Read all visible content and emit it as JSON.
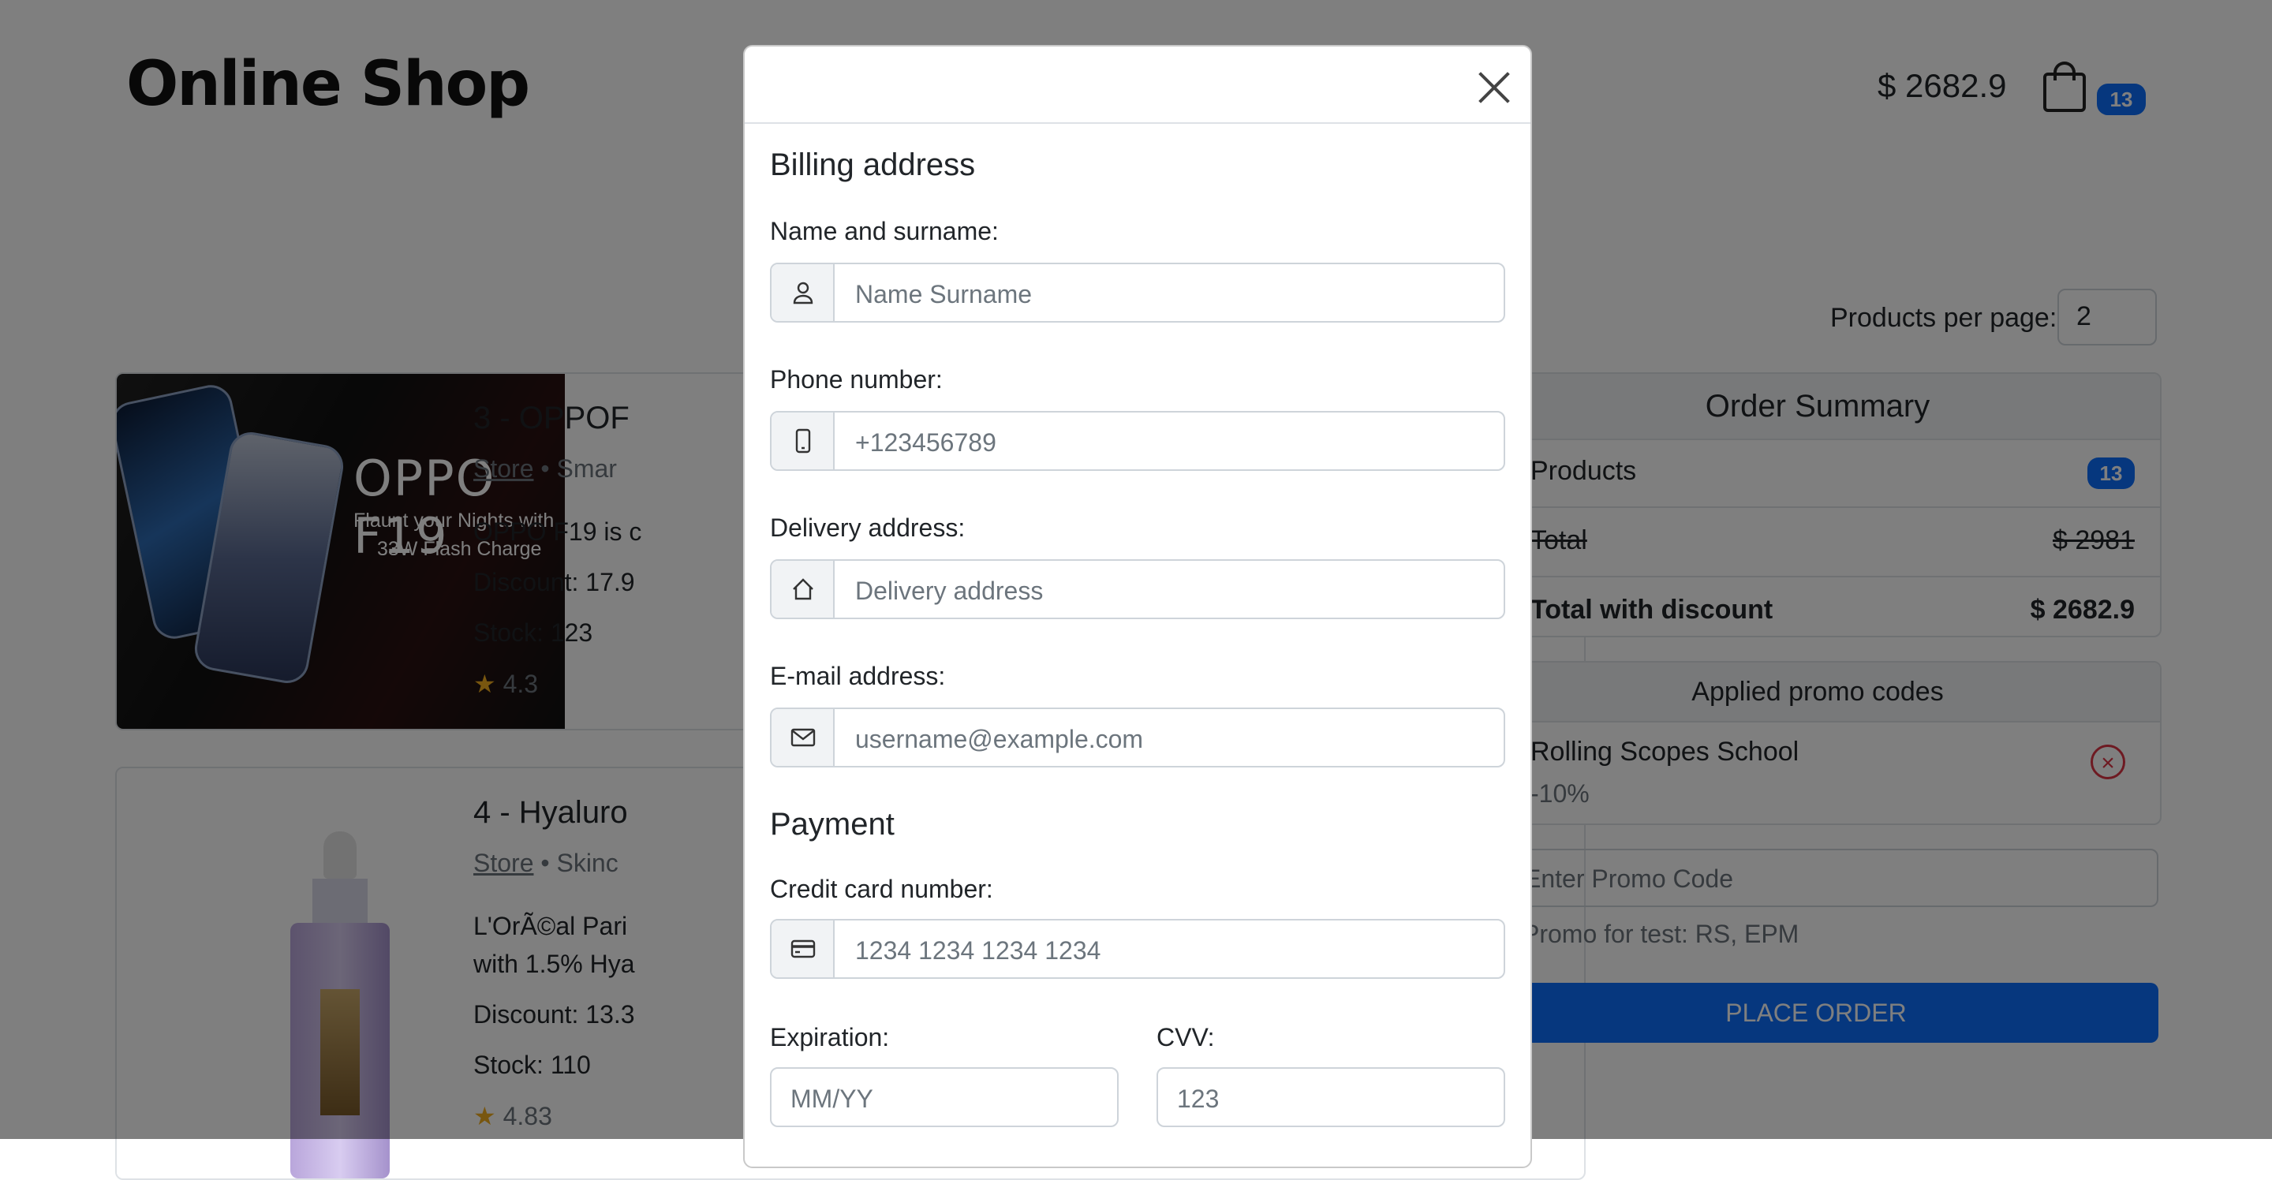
{
  "header": {
    "brand": "Online Shop",
    "total_price": "$ 2682.9",
    "cart_count": "13"
  },
  "controls": {
    "products_per_page_label": "Products per page:",
    "products_per_page_value": "2"
  },
  "products": [
    {
      "title": "3 - OPPOF",
      "store": "Store",
      "category": "Smar",
      "description": "OPPO F19 is c",
      "discount": "Discount: 17.9",
      "stock": "Stock: 123",
      "rating": "4.3",
      "image_text": {
        "title": "OPPO F19",
        "line1": "Flaunt your Nights with",
        "line2": "33W Flash Charge"
      }
    },
    {
      "title": "4 - Hyaluro",
      "store": "Store",
      "category": "Skinc",
      "description_line1": "L'OrÃ©al Pari",
      "description_line2": "with 1.5% Hya",
      "discount": "Discount: 13.3",
      "stock": "Stock: 110",
      "rating": "4.83"
    }
  ],
  "summary": {
    "title": "Order Summary",
    "products_label": "Products",
    "products_count": "13",
    "total_label": "Total",
    "total_value": "$ 2981",
    "discount_label": "Total with discount",
    "discount_value": "$ 2682.9"
  },
  "promo": {
    "title": "Applied promo codes",
    "code_name": "Rolling Scopes School",
    "code_discount": "-10%",
    "input_placeholder": "Enter Promo Code",
    "hint": "Promo for test: RS, EPM",
    "place_order": "PLACE ORDER"
  },
  "modal": {
    "billing_title": "Billing address",
    "name_label": "Name and surname:",
    "name_placeholder": "Name Surname",
    "phone_label": "Phone number:",
    "phone_placeholder": "+123456789",
    "address_label": "Delivery address:",
    "address_placeholder": "Delivery address",
    "email_label": "E-mail address:",
    "email_placeholder": "username@example.com",
    "payment_title": "Payment",
    "card_label": "Credit card number:",
    "card_placeholder": "1234 1234 1234 1234",
    "expiration_label": "Expiration:",
    "expiration_placeholder": "MM/YY",
    "cvv_label": "CVV:",
    "cvv_placeholder": "123"
  },
  "icons": {
    "close": "close-icon",
    "cart": "shopping-bag-icon",
    "person": "person-icon",
    "phone": "phone-icon",
    "house": "house-icon",
    "email": "envelope-icon",
    "card": "credit-card-icon",
    "star": "star-icon",
    "remove": "remove-icon"
  },
  "colors": {
    "accent": "#0d6efd",
    "danger": "#dc3545",
    "star": "#f0ad1e",
    "backdrop": "rgba(0,0,0,0.5)"
  }
}
